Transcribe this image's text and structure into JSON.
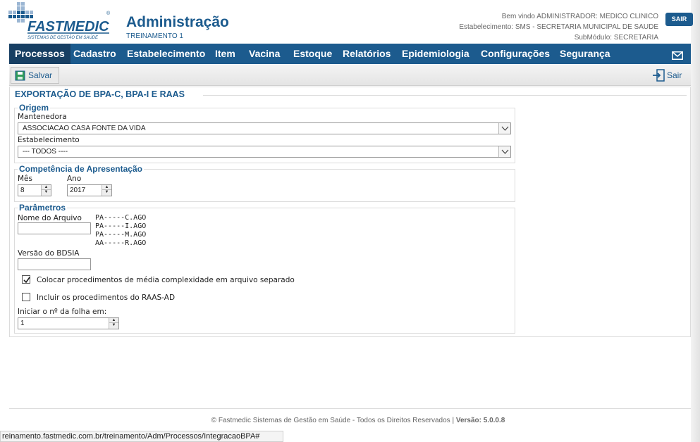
{
  "header": {
    "logo_text": "FASTMEDIC",
    "logo_tagline": "SISTEMAS DE GESTÃO EM SAÚDE",
    "title": "Administração",
    "subtitle": "TREINAMENTO 1",
    "welcome": "Bem vindo ADMINISTRADOR: MEDICO CLINICO",
    "establishment": "Estabelecimento: SMS - SECRETARIA MUNICIPAL DE SAUDE",
    "submodule": "SubMódulo: SECRETARIA",
    "logout_label": "SAIR"
  },
  "nav": {
    "items": [
      {
        "label": "Processos",
        "active": true
      },
      {
        "label": "Cadastro"
      },
      {
        "label": "Estabelecimento"
      },
      {
        "label": "Item"
      },
      {
        "label": "Vacina"
      },
      {
        "label": "Estoque"
      },
      {
        "label": "Relatórios"
      },
      {
        "label": "Epidemiologia"
      },
      {
        "label": "Configurações"
      },
      {
        "label": "Segurança"
      }
    ],
    "mail_icon": "envelope-icon"
  },
  "toolbar": {
    "save_label": "Salvar",
    "exit_label": "Sair"
  },
  "main": {
    "heading": "EXPORTAÇÃO DE BPA-C, BPA-I E RAAS",
    "origem": {
      "legend": "Origem",
      "mantenedora_label": "Mantenedora",
      "mantenedora_value": "ASSOCIACAO CASA FONTE DA VIDA",
      "estabelecimento_label": "Estabelecimento",
      "estabelecimento_value": "--- TODOS ----"
    },
    "competencia": {
      "legend": "Competência de Apresentação",
      "mes_label": "Mês",
      "mes_value": "8",
      "ano_label": "Ano",
      "ano_value": "2017"
    },
    "parametros": {
      "legend": "Parâmetros",
      "nome_arquivo_label": "Nome do Arquivo",
      "nome_arquivo_value": "",
      "file_patterns": [
        "PA-----C.AGO",
        "PA-----I.AGO",
        "PA-----M.AGO",
        "AA-----R.AGO"
      ],
      "versao_label": "Versão do BDSIA",
      "versao_value": "",
      "check_media_label": "Colocar procedimentos de média complexidade em arquivo separado",
      "check_media_checked": true,
      "check_raas_label": "Incluir os procedimentos do RAAS-AD",
      "check_raas_checked": false,
      "folha_label": "Iniciar o nº da folha em:",
      "folha_value": "1"
    }
  },
  "footer": {
    "copyright": "© Fastmedic Sistemas de Gestão em Saúde - Todos os Direitos Reservados |",
    "version": "Versão: 5.0.0.8"
  },
  "statusbar": {
    "url": "reinamento.fastmedic.com.br/treinamento/Adm/Processos/IntegracaoBPA#"
  },
  "colors": {
    "brand_blue": "#1c5b8e",
    "nav_active": "#173f63"
  }
}
